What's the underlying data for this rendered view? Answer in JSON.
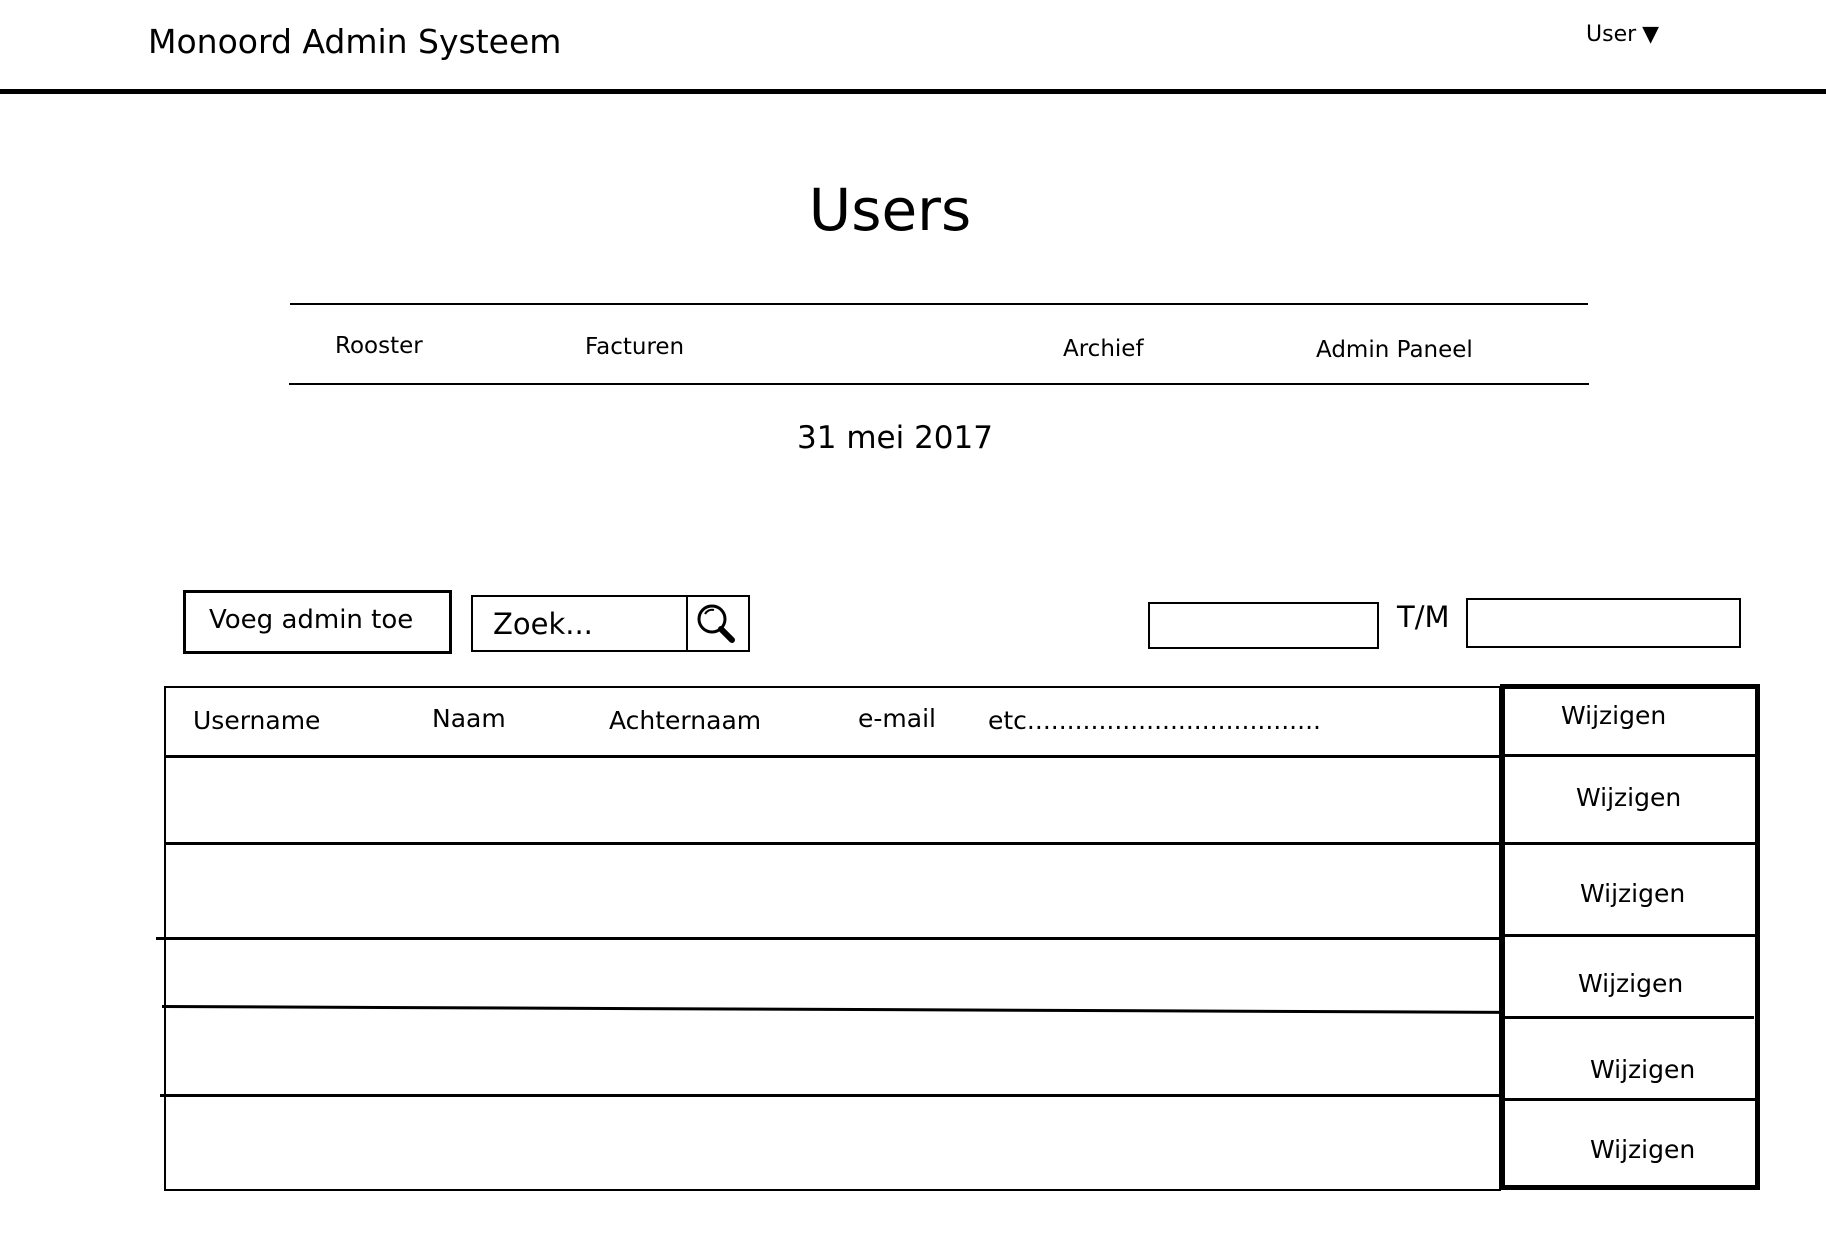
{
  "header": {
    "app_title": "Monoord Admin Systeem",
    "user_menu_label": "User",
    "user_menu_icon": "caret-down-icon"
  },
  "page": {
    "title": "Users",
    "date": "31 mei 2017"
  },
  "nav": {
    "items": [
      {
        "label": "Rooster"
      },
      {
        "label": "Facturen"
      },
      {
        "label": "Archief"
      },
      {
        "label": "Admin Paneel"
      }
    ]
  },
  "toolbar": {
    "add_admin_label": "Voeg admin toe",
    "search_placeholder": "Zoek...",
    "search_icon": "magnifier-icon",
    "range_separator": "T/M",
    "date_from_value": "",
    "date_to_value": ""
  },
  "table": {
    "columns": [
      "Username",
      "Naam",
      "Achternaam",
      "e-mail",
      "etc....................................."
    ],
    "action_label": "Wijzigen",
    "rows": [
      {
        "action": "Wijzigen"
      },
      {
        "action": "Wijzigen"
      },
      {
        "action": "Wijzigen"
      },
      {
        "action": "Wijzigen"
      },
      {
        "action": "Wijzigen"
      },
      {
        "action": "Wijzigen"
      }
    ]
  }
}
